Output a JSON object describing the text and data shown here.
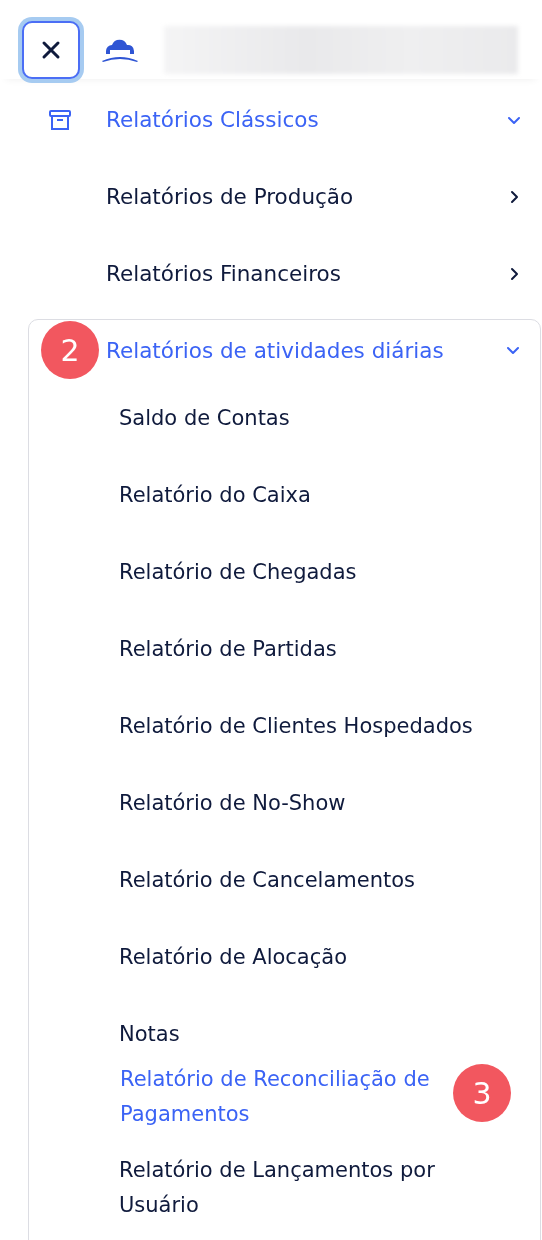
{
  "sections": [
    {
      "label": "Relatórios Clássicos",
      "selected": true,
      "expanded": true,
      "children": [
        {
          "label": "Relatórios de Produção",
          "selected": false,
          "expanded": false
        },
        {
          "label": "Relatórios Financeiros",
          "selected": false,
          "expanded": false
        },
        {
          "label": "Relatórios de atividades diárias",
          "selected": true,
          "expanded": true,
          "badge": "2",
          "children": [
            {
              "label": "Saldo de Contas",
              "selected": false
            },
            {
              "label": "Relatório do Caixa",
              "selected": false
            },
            {
              "label": "Relatório de Chegadas",
              "selected": false
            },
            {
              "label": "Relatório de Partidas",
              "selected": false
            },
            {
              "label": "Relatório de Clientes Hospedados",
              "selected": false
            },
            {
              "label": "Relatório de No-Show",
              "selected": false
            },
            {
              "label": "Relatório de Cancelamentos",
              "selected": false
            },
            {
              "label": "Relatório de Alocação",
              "selected": false
            },
            {
              "label": "Notas",
              "selected": false
            },
            {
              "label": "Relatório de Reconciliação de Pagamentos",
              "selected": true,
              "badge": "3"
            },
            {
              "label": "Relatório de Lançamentos por Usuário",
              "selected": false
            }
          ]
        }
      ]
    }
  ]
}
